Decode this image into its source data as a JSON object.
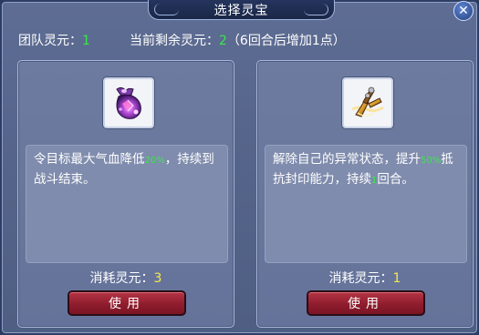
{
  "window": {
    "title": "选择灵宝",
    "close_label": "✕"
  },
  "team_energy": {
    "label": "团队灵元：",
    "value": "1"
  },
  "remaining_energy": {
    "label": "当前剩余灵元：",
    "value": "2",
    "note": "（6回合后增加1点）"
  },
  "cards": [
    {
      "icon": "purple-gem-pouch-icon",
      "desc_part1": "令目标最大气血降低",
      "desc_highlight1": "20%",
      "desc_part2": "，持续到战斗结束。",
      "cost_label": "消耗灵元：",
      "cost_value": "3",
      "button_label": "使用"
    },
    {
      "icon": "golden-claw-artifact-icon",
      "desc_part1": "解除自己的异常状态，提升",
      "desc_highlight1": "50%",
      "desc_part2": "抵抗封印能力，持续",
      "desc_highlight2": "1",
      "desc_part3": "回合。",
      "cost_label": "消耗灵元：",
      "cost_value": "1",
      "button_label": "使用"
    }
  ],
  "colors": {
    "accent_green": "#39e84a",
    "cost_yellow": "#f4e84b",
    "button_red": "#8f1d2d",
    "panel_blue": "#56658b"
  }
}
